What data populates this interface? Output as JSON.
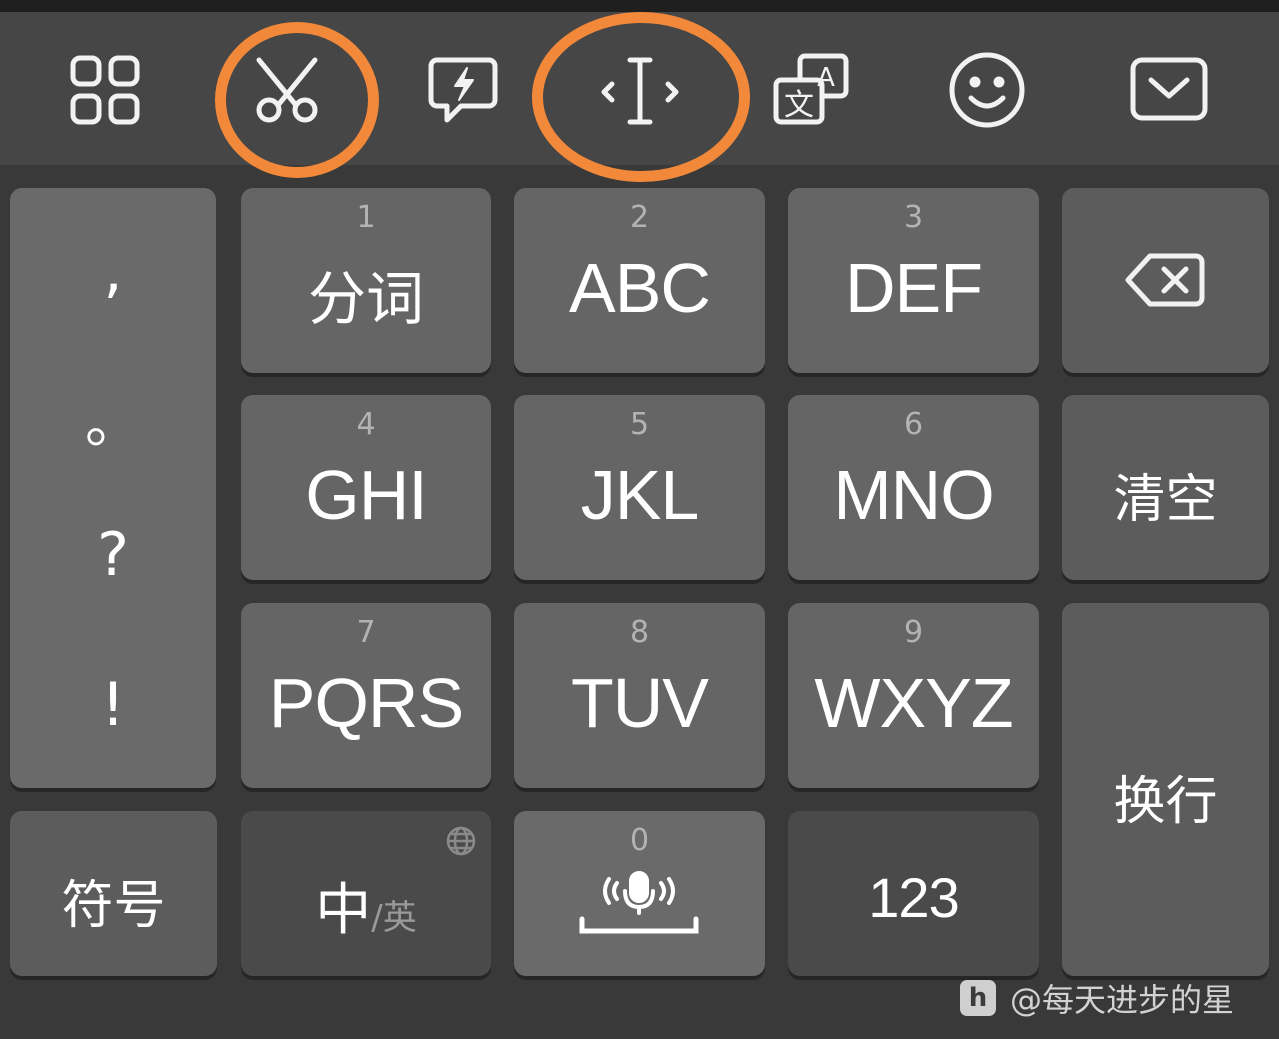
{
  "toolbar": {
    "icons": [
      "apps-grid-icon",
      "scissors-icon",
      "quick-phrase-icon",
      "cursor-move-icon",
      "translate-icon",
      "emoji-icon",
      "hide-keyboard-icon"
    ],
    "highlight_color": "#f2893a"
  },
  "punct_column": [
    ",",
    "。",
    "?",
    "!"
  ],
  "keys": {
    "k1": {
      "num": "1",
      "label": "分词"
    },
    "k2": {
      "num": "2",
      "label": "ABC"
    },
    "k3": {
      "num": "3",
      "label": "DEF"
    },
    "k4": {
      "num": "4",
      "label": "GHI"
    },
    "k5": {
      "num": "5",
      "label": "JKL"
    },
    "k6": {
      "num": "6",
      "label": "MNO"
    },
    "k7": {
      "num": "7",
      "label": "PQRS"
    },
    "k8": {
      "num": "8",
      "label": "TUV"
    },
    "k9": {
      "num": "9",
      "label": "WXYZ"
    },
    "k0": {
      "num": "0"
    }
  },
  "right_column": {
    "backspace_icon": "backspace-icon",
    "clear": "清空",
    "enter": "换行"
  },
  "bottom_row": {
    "symbols": "符号",
    "lang_main": "中",
    "lang_alt": "/英",
    "globe_icon": "globe-icon",
    "mic_icon": "microphone-icon",
    "numbers": "123"
  },
  "watermark": {
    "logo_letter": "h",
    "text": "@每天进步的星"
  }
}
